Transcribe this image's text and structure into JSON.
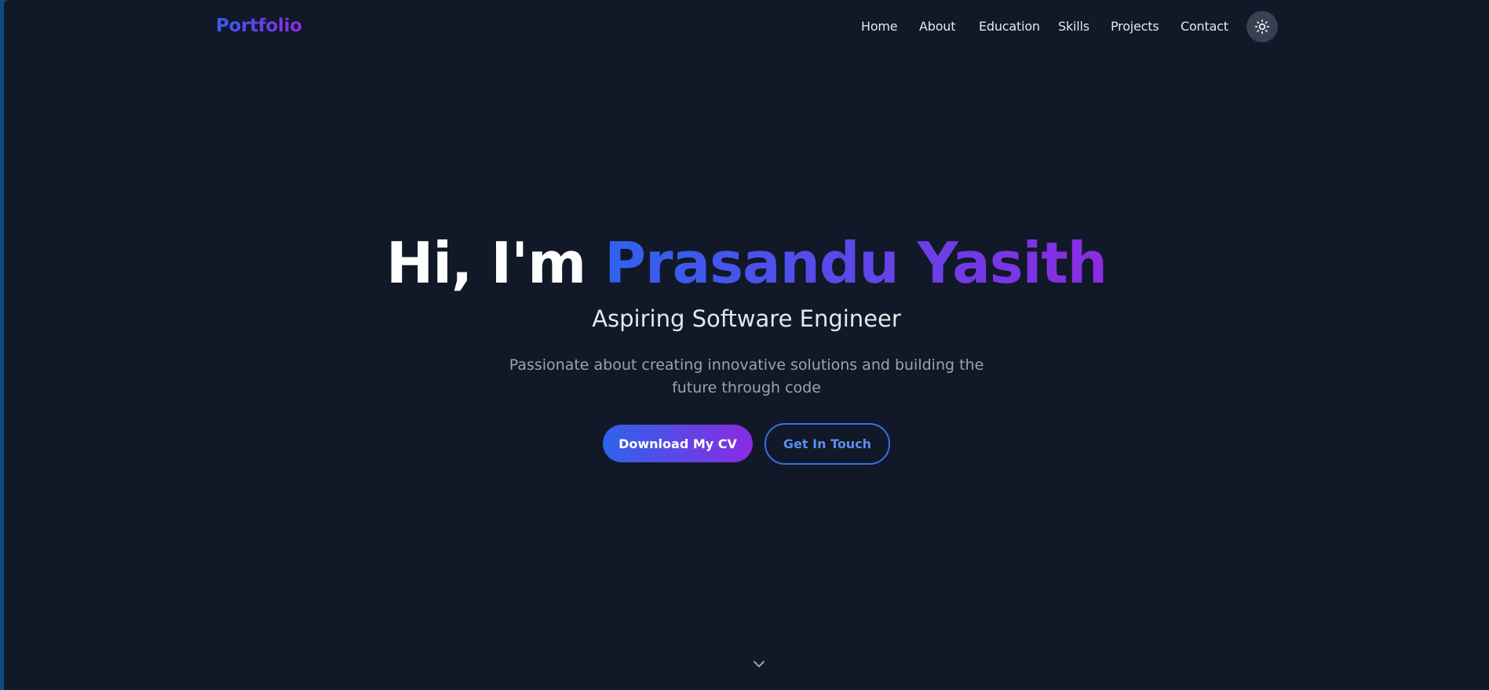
{
  "nav": {
    "logo": "Portfolio",
    "links": [
      "Home",
      "About",
      "Education",
      "Skills",
      "Projects",
      "Contact"
    ],
    "theme_toggle_icon": "sun-icon"
  },
  "hero": {
    "greeting": "Hi, I'm ",
    "name": "Prasandu Yasith",
    "role": "Aspiring Software Engineer",
    "description": "Passionate about creating innovative solutions and building the future through code",
    "primary_button": "Download My CV",
    "secondary_button": "Get In Touch",
    "scroll_icon": "chevron-down-icon"
  },
  "colors": {
    "background": "#111827",
    "gradient_start": "#2f63ee",
    "gradient_end": "#8b2be2",
    "outline_accent": "#3b6fe8"
  }
}
